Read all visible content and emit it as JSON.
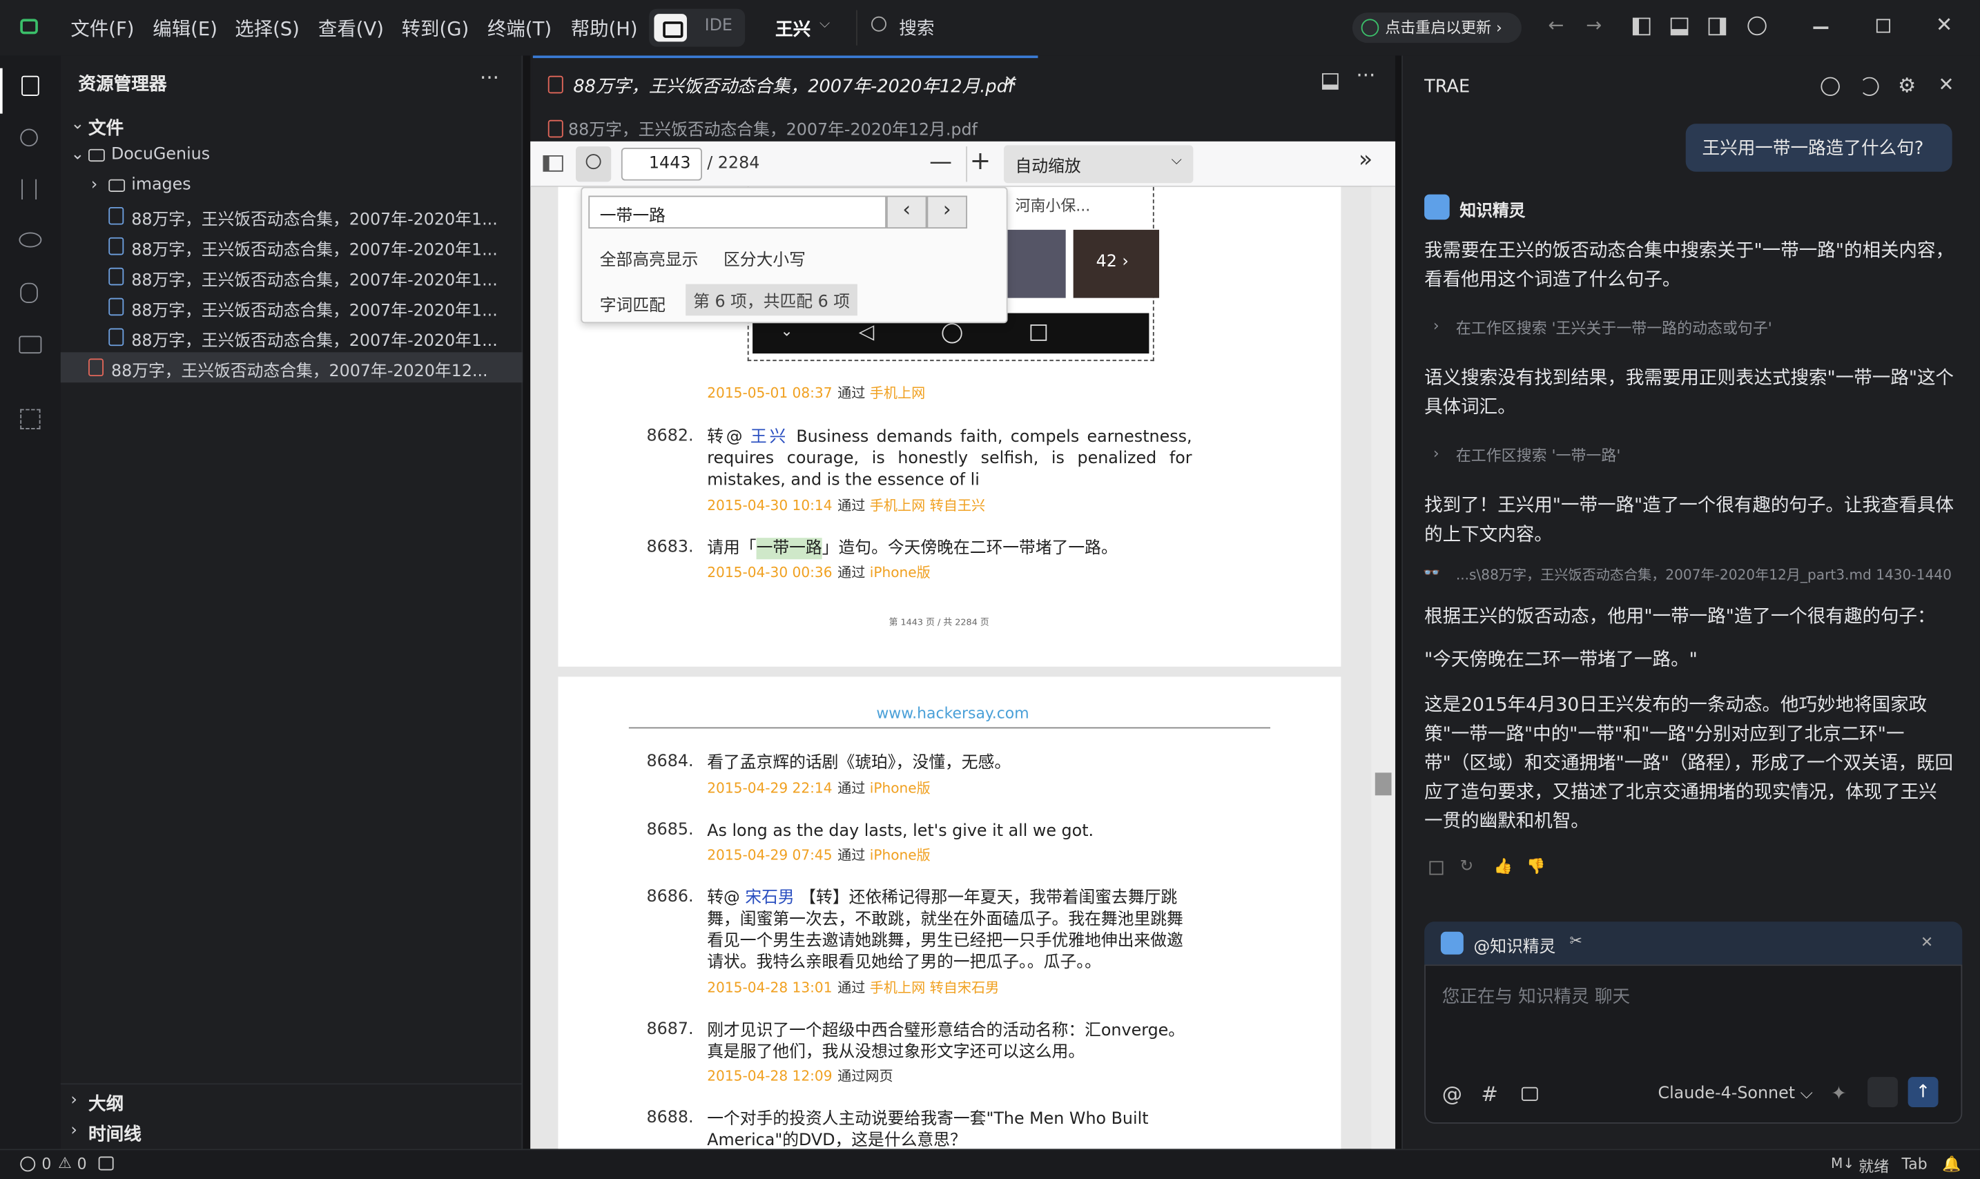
{
  "menu": [
    "文件(F)",
    "编辑(E)",
    "选择(S)",
    "查看(V)",
    "转到(G)",
    "终端(T)",
    "帮助(H)"
  ],
  "ide_label": "IDE",
  "workspace": "王兴",
  "search_label": "搜索",
  "restart_label": "点击重启以更新",
  "explorer": {
    "title": "资源管理器",
    "section_files": "文件",
    "folder": "DocuGenius",
    "subfolder": "images",
    "files": [
      "88万字，王兴饭否动态合集，2007年-2020年1...",
      "88万字，王兴饭否动态合集，2007年-2020年1...",
      "88万字，王兴饭否动态合集，2007年-2020年1...",
      "88万字，王兴饭否动态合集，2007年-2020年1...",
      "88万字，王兴饭否动态合集，2007年-2020年1..."
    ],
    "active_file": "88万字，王兴饭否动态合集，2007年-2020年12...",
    "outline": "大纲",
    "timeline": "时间线"
  },
  "editor": {
    "tab_title": "88万字，王兴饭否动态合集，2007年-2020年12月.pdf",
    "breadcrumb": "88万字，王兴饭否动态合集，2007年-2020年12月.pdf",
    "page_current": "1443",
    "page_total": "/ 2284",
    "zoom": "自动缩放",
    "find": {
      "query": "一带一路",
      "highlight_all": "全部高亮显示",
      "match_case": "区分大小写",
      "whole_word": "字词匹配",
      "result": "第 6 项，共匹配 6 项"
    },
    "thumb_label": "河南小保...",
    "thumb_count": "42",
    "entries_top": [
      {
        "meta_date": "2015-05-01 08:37",
        "via": "通过",
        "src": "手机上网"
      },
      {
        "num": "8682.",
        "prefix": "转@ ",
        "user": "王兴",
        "text": " Business demands faith, compels earnestness, requires courage, is honestly selfish, is penalized for mistakes, and is the essence of li",
        "meta_date": "2015-04-30 10:14",
        "via": "通过",
        "src": "手机上网  转自王兴"
      },
      {
        "num": "8683.",
        "text_a": "请用「",
        "hl": "一带一路",
        "text_b": "」造句。今天傍晚在二环一带堵了一路。",
        "meta_date": "2015-04-30 00:36",
        "via": "通过",
        "src": "iPhone版"
      }
    ],
    "page_footer": "第 1443 页 / 共 2284 页",
    "site": "www.hackersay.com",
    "entries_bottom": [
      {
        "num": "8684.",
        "text": "看了孟京辉的话剧《琥珀》，没懂，无感。",
        "meta_date": "2015-04-29 22:14",
        "via": "通过",
        "src": "iPhone版"
      },
      {
        "num": "8685.",
        "text": "As long as the day lasts, let's give it all we got.",
        "meta_date": "2015-04-29 07:45",
        "via": "通过",
        "src": "iPhone版"
      },
      {
        "num": "8686.",
        "prefix": "转@ ",
        "user": "宋石男",
        "text": " 【转】还依稀记得那一年夏天，我带着闺蜜去舞厅跳舞，闺蜜第一次去，不敢跳，就坐在外面磕瓜子。我在舞池里跳舞看见一个男生去邀请她跳舞，男生已经把一只手优雅地伸出来做邀请状。我特么亲眼看见她给了男的一把瓜子。。瓜子。。",
        "meta_date": "2015-04-28 13:01",
        "via": "通过",
        "src": "手机上网  转自宋石男"
      },
      {
        "num": "8687.",
        "text": "刚才见识了一个超级中西合璧形意结合的活动名称：汇onverge。 真是服了他们，我从没想过象形文字还可以这么用。",
        "meta_date": "2015-04-28 12:09",
        "via": "通过网页",
        "src": ""
      },
      {
        "num": "8688.",
        "text": "一个对手的投资人主动说要给我寄一套\"The Men Who Built America\"的DVD，这是什么意思？",
        "meta_date": "",
        "via": "",
        "src": ""
      }
    ]
  },
  "ai": {
    "title": "TRAE",
    "user_msg": "王兴用一带一路造了什么句?",
    "agent": "知识精灵",
    "p1": "我需要在王兴的饭否动态合集中搜索关于\"一带一路\"的相关内容，看看他用这个词造了什么句子。",
    "tool1": "在工作区搜索 '王兴关于一带一路的动态或句子'",
    "p2": "语义搜索没有找到结果，我需要用正则表达式搜索\"一带一路\"这个具体词汇。",
    "tool2": "在工作区搜索 '一带一路'",
    "p3": "找到了！王兴用\"一带一路\"造了一个很有趣的句子。让我查看具体的上下文内容。",
    "file_ref": "...s\\88万字，王兴饭否动态合集，2007年-2020年12月_part3.md  1430-1440",
    "p4": "根据王兴的饭否动态，他用\"一带一路\"造了一个很有趣的句子：",
    "quote": "\"今天傍晚在二环一带堵了一路。\"",
    "p5": "这是2015年4月30日王兴发布的一条动态。他巧妙地将国家政策\"一带一路\"中的\"一带\"和\"一路\"分别对应到了北京二环\"一带\"（区域）和交通拥堵\"一路\"（路程），形成了一个双关语，既回应了造句要求，又描述了北京交通拥堵的现实情况，体现了王兴一贯的幽默和机智。",
    "mention": "@知识精灵",
    "placeholder": "您正在与 知识精灵 聊天",
    "model": "Claude-4-Sonnet"
  },
  "status": {
    "errors": "0",
    "warnings": "0",
    "ready": "就绪",
    "tab": "Tab",
    "md": "M↓"
  }
}
